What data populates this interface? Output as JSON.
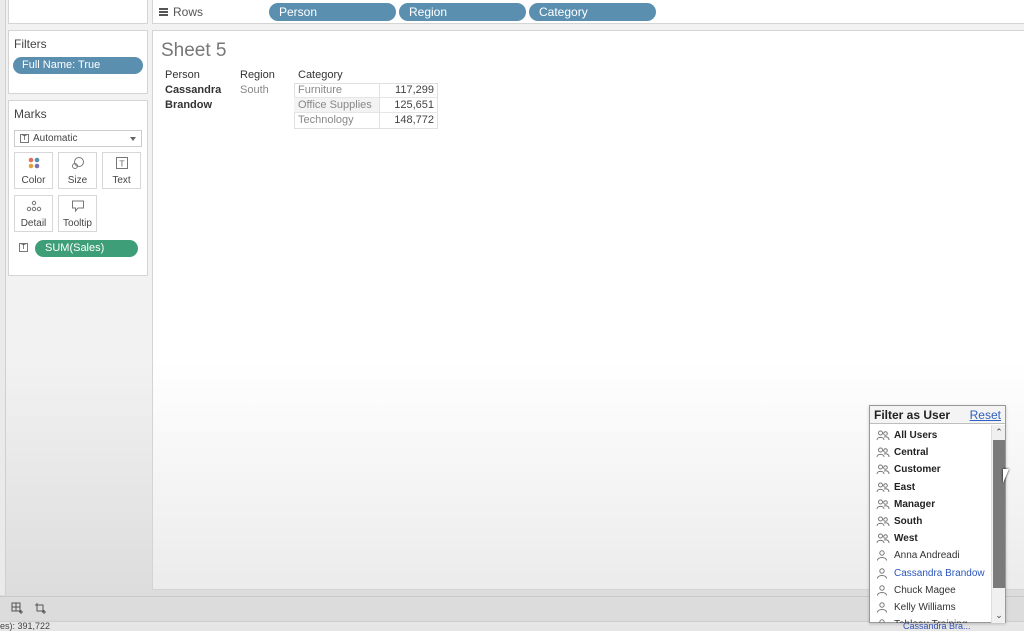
{
  "shelves": {
    "rows_label": "Rows",
    "rows_pills": [
      "Person",
      "Region",
      "Category"
    ]
  },
  "filters": {
    "title": "Filters",
    "pill": "Full Name: True"
  },
  "marks": {
    "title": "Marks",
    "type": "Automatic",
    "buttons": [
      "Color",
      "Size",
      "Text",
      "Detail",
      "Tooltip"
    ],
    "measure_pill": "SUM(Sales)"
  },
  "sheet": {
    "title": "Sheet 5",
    "headers": [
      "Person",
      "Region",
      "Category"
    ],
    "person_line1": "Cassandra",
    "person_line2": "Brandow",
    "region": "South",
    "rows": [
      {
        "category": "Furniture",
        "value": "117,299"
      },
      {
        "category": "Office Supplies",
        "value": "125,651"
      },
      {
        "category": "Technology",
        "value": "148,772"
      }
    ]
  },
  "filter_as_user": {
    "title": "Filter as User",
    "reset": "Reset",
    "items": [
      {
        "label": "All Users",
        "kind": "group"
      },
      {
        "label": "Central",
        "kind": "group"
      },
      {
        "label": "Customer",
        "kind": "group"
      },
      {
        "label": "East",
        "kind": "group"
      },
      {
        "label": "Manager",
        "kind": "group"
      },
      {
        "label": "South",
        "kind": "group"
      },
      {
        "label": "West",
        "kind": "group"
      },
      {
        "label": "Anna Andreadi",
        "kind": "user"
      },
      {
        "label": "Cassandra Brandow",
        "kind": "user",
        "selected": true
      },
      {
        "label": "Chuck Magee",
        "kind": "user"
      },
      {
        "label": "Kelly Williams",
        "kind": "user"
      },
      {
        "label": "Tableau Training",
        "kind": "user"
      }
    ]
  },
  "status": {
    "left": "es): 391,722",
    "user": "Cassandra Bra..."
  },
  "colors": {
    "dimension_pill": "#5b8fb0",
    "measure_pill": "#3e9e78",
    "link": "#2f5fbf"
  }
}
